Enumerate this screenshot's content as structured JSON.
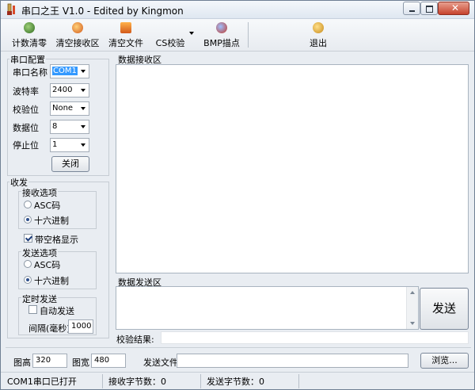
{
  "window": {
    "title": "串口之王 V1.0 - Edited by Kingmon"
  },
  "toolbar": {
    "count_clear": "计数清零",
    "clear_receive": "清空接收区",
    "clear_file": "清空文件",
    "cs_check": "CS校验",
    "bmp_trace": "BMP描点",
    "exit": "退出"
  },
  "serial_config": {
    "group_title": "串口配置",
    "port_label": "串口名称",
    "port_value": "COM1",
    "baud_label": "波特率",
    "baud_value": "2400",
    "parity_label": "校验位",
    "parity_value": "None",
    "databits_label": "数据位",
    "databits_value": "8",
    "stopbits_label": "停止位",
    "stopbits_value": "1",
    "close_button": "关闭"
  },
  "transceive": {
    "group_title": "收发",
    "receive_options_title": "接收选项",
    "receive_asc": "ASC码",
    "receive_hex": "十六进制",
    "receive_mode": "hex",
    "space_display": "带空格显示",
    "space_display_checked": true,
    "send_options_title": "发送选项",
    "send_asc": "ASC码",
    "send_hex": "十六进制",
    "send_mode": "hex",
    "timed_send_title": "定时发送",
    "auto_send": "自动发送",
    "auto_send_checked": false,
    "interval_label": "间隔(毫秒)",
    "interval_value": "1000"
  },
  "receive_area": {
    "title": "数据接收区"
  },
  "send_area": {
    "title": "数据发送区",
    "send_button": "发送",
    "check_result_label": "校验结果:"
  },
  "bottom": {
    "height_label": "图高",
    "height_value": "320",
    "width_label": "图宽",
    "width_value": "480",
    "send_file_label": "发送文件",
    "browse_button": "浏览..."
  },
  "status": {
    "port_status": "COM1串口已打开",
    "received_bytes": "接收字节数：0",
    "sent_bytes": "发送字节数：0"
  },
  "colors": {
    "accent": "#3399ff",
    "window_bg": "#e9edf2",
    "close_button": "#c7432d"
  },
  "icons": [
    "app-icon",
    "counter-icon",
    "clear-receive-icon",
    "clear-file-icon",
    "cs-check-icon",
    "bmp-icon",
    "exit-icon",
    "dropdown-arrow-icon"
  ]
}
